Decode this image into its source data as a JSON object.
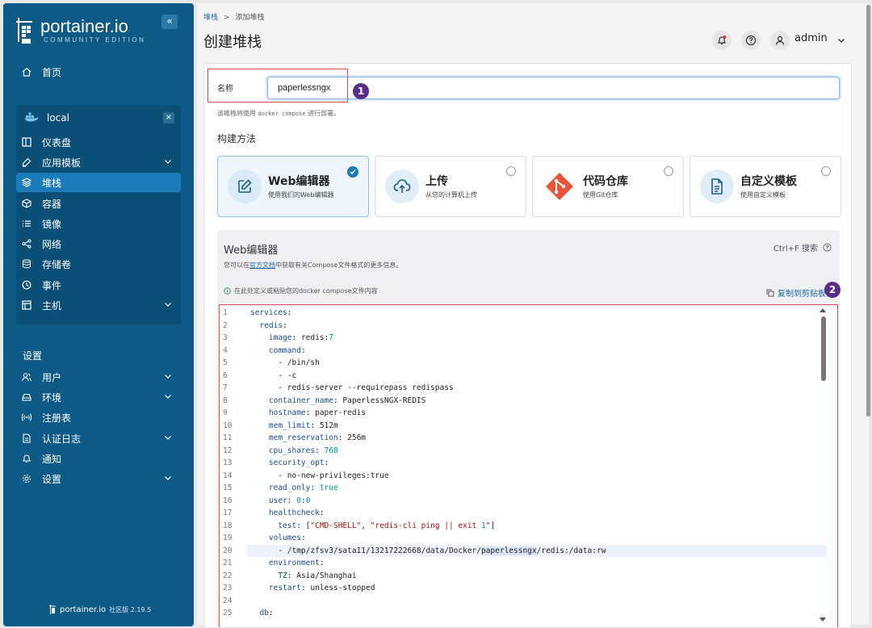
{
  "brand": {
    "name": "portainer.io",
    "edition": "COMMUNITY EDITION",
    "footer_name": "portainer.io",
    "footer_sub": "社区版 2.19.5",
    "collapse": "«"
  },
  "sidebar": {
    "home": "首页",
    "environment": {
      "name": "local",
      "close": "×"
    },
    "env_items": [
      {
        "label": "仪表盘",
        "icon": "dashboard-icon"
      },
      {
        "label": "应用模板",
        "icon": "edit-icon",
        "chevron": true
      },
      {
        "label": "堆栈",
        "icon": "stack-icon",
        "active": true
      },
      {
        "label": "容器",
        "icon": "container-icon"
      },
      {
        "label": "镜像",
        "icon": "list-icon"
      },
      {
        "label": "网络",
        "icon": "network-icon"
      },
      {
        "label": "存储卷",
        "icon": "database-icon"
      },
      {
        "label": "事件",
        "icon": "clock-icon"
      },
      {
        "label": "主机",
        "icon": "host-icon",
        "chevron": true
      }
    ],
    "settings_title": "设置",
    "settings_items": [
      {
        "label": "用户",
        "icon": "users-icon",
        "chevron": true
      },
      {
        "label": "环境",
        "icon": "server-icon",
        "chevron": true
      },
      {
        "label": "注册表",
        "icon": "radio-icon"
      },
      {
        "label": "认证日志",
        "icon": "file-icon",
        "chevron": true
      },
      {
        "label": "通知",
        "icon": "bell-icon"
      },
      {
        "label": "设置",
        "icon": "gear-icon",
        "chevron": true
      }
    ]
  },
  "header": {
    "breadcrumb_link": "堆栈",
    "breadcrumb_sep": ">",
    "breadcrumb_current": "添加堆栈",
    "title": "创建堆栈",
    "user": "admin"
  },
  "form": {
    "name_label": "名称",
    "name_value": "paperlessngx",
    "hint_prefix": "该堆栈将使用",
    "hint_code": "docker compose",
    "hint_suffix": "进行部署。",
    "build_method_label": "构建方法",
    "methods": [
      {
        "title": "Web编辑器",
        "sub": "使用我们的Web编辑器",
        "selected": true
      },
      {
        "title": "上传",
        "sub": "从您的计算机上传",
        "selected": false
      },
      {
        "title": "代码仓库",
        "sub": "使用Git仓库",
        "selected": false
      },
      {
        "title": "自定义模板",
        "sub": "使用自定义模板",
        "selected": false
      }
    ]
  },
  "annotations": {
    "badge1": "1",
    "badge2": "2"
  },
  "editor": {
    "title": "Web编辑器",
    "search": "Ctrl+F 搜索",
    "desc_prefix": "您可以在",
    "desc_link": "官方文档",
    "desc_suffix": "中获取有关Compose文件格式的更多信息。",
    "info": "在此处定义或粘贴您的docker compose文件内容",
    "copy": "复制到剪贴板",
    "highlight_line": 20,
    "lines": [
      "services:",
      "  redis:",
      "    image: redis:7",
      "    command:",
      "      - /bin/sh",
      "      - -c",
      "      - redis-server --requirepass redispass",
      "    container_name: PaperlessNGX-REDIS",
      "    hostname: paper-redis",
      "    mem_limit: 512m",
      "    mem_reservation: 256m",
      "    cpu_shares: 768",
      "    security_opt:",
      "      - no-new-privileges:true",
      "    read_only: true",
      "    user: 0:0",
      "    healthcheck:",
      "      test: [\"CMD-SHELL\", \"redis-cli ping || exit 1\"]",
      "    volumes:",
      "      - /tmp/zfsv3/sata11/13217222668/data/Docker/paperlessngx/redis:/data:rw",
      "    environment:",
      "      TZ: Asia/Shanghai",
      "    restart: unless-stopped",
      "",
      "  db:"
    ],
    "line_numbers": [
      "1",
      "2",
      "3",
      "4",
      "5",
      "6",
      "7",
      "8",
      "9",
      "10",
      "11",
      "12",
      "13",
      "14",
      "15",
      "16",
      "17",
      "18",
      "19",
      "20",
      "21",
      "22",
      "23",
      "24",
      "25"
    ]
  },
  "colors": {
    "sidebar": "#0d5a86",
    "accent": "#1b7bb8",
    "annotation": "#d94f4f",
    "badge": "#5b2d8a"
  }
}
